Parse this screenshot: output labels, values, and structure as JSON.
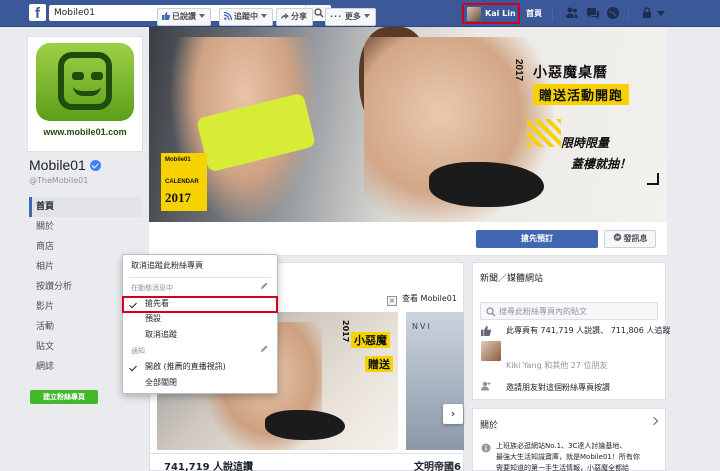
{
  "topbar": {
    "logo": "f",
    "search_value": "Mobile01",
    "user_name": "Kai Lin",
    "home_label": "首頁",
    "icons": [
      "friends-icon",
      "messages-icon",
      "globe-icon",
      "lock-icon",
      "account-menu-icon"
    ]
  },
  "page": {
    "logo_url_text": "www.mobile01.com",
    "name": "Mobile01",
    "handle": "@TheMobile01"
  },
  "sidebar": {
    "items": [
      {
        "label": "首頁",
        "active": true
      },
      {
        "label": "關於"
      },
      {
        "label": "商店"
      },
      {
        "label": "相片"
      },
      {
        "label": "按讚分析"
      },
      {
        "label": "影片"
      },
      {
        "label": "活動"
      },
      {
        "label": "貼文"
      },
      {
        "label": "網誌"
      }
    ],
    "create_button": "建立粉絲專頁"
  },
  "cover": {
    "badge_small": "Mobile01",
    "badge_calendar": "CALENDAR",
    "badge_year": "2017",
    "year_vertical": "2017",
    "title1": "小惡魔桌曆",
    "title2": "贈送活動開跑",
    "sub1": "限時限量",
    "sub2": "蓋樓就抽！"
  },
  "actions": {
    "liked": "已說讚",
    "following": "追蹤中",
    "share": "分享",
    "more": "更多",
    "primary": "搶先預訂",
    "send_message": "發訊息"
  },
  "dropdown": {
    "unfollow": "取消追蹤此粉絲專頁",
    "news_feed_header": "在動態消息中",
    "see_first": "搶先看",
    "default": "預設",
    "unfollow_short": "取消追蹤",
    "notifications_header": "通知",
    "on_live": "開啟 (推薦的直播視訊)",
    "all_off": "全部關閉"
  },
  "feed": {
    "right_tab": "查看 Mobile01",
    "ad_year": "2017",
    "ad_title1": "小惡魔",
    "ad_title2": "贈送",
    "ad2_text": "NVI",
    "next": "›",
    "caption1": "741,719 人說這讚",
    "caption2": "文明帝國6"
  },
  "right": {
    "news_header": "新聞／媒體網站",
    "search_placeholder": "搜尋此粉絲專頁內的貼文",
    "likes_line": "此專頁有 741,719 人說讚、 711,806 人追蹤",
    "friends_line": "Kiki Yang 和其他 27 位朋友",
    "invite": "邀請朋友對這個粉絲專頁按讚",
    "about_header": "關於",
    "about_text1": "上班族必逛網站No.1、3C達人討論基地、",
    "about_text2": "最強大生活知識寶庫，就是Mobile01！所有你",
    "about_text3": "需要知道的第一手生活情報，小惡魔全都給"
  },
  "colors": {
    "brand_blue": "#3b5998",
    "primary_button": "#4267b2",
    "highlight_red": "#d0021b",
    "accent_yellow": "#f6d200",
    "create_green": "#42b72a"
  }
}
